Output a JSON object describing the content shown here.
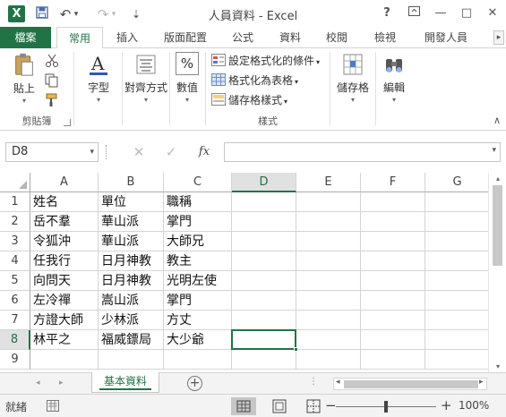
{
  "window": {
    "app_title": "人員資料 - Excel",
    "help": "?",
    "ribbon_display": "▭",
    "minimize": "—",
    "restore": "□",
    "close": "✕"
  },
  "quick_access": {
    "save": "💾",
    "undo": "↶",
    "undo_dd": "▾",
    "redo": "↷",
    "redo_dd": "▾",
    "customize": "⇣"
  },
  "ribbon_tabs": [
    "檔案",
    "常用",
    "插入",
    "版面配置",
    "公式",
    "資料",
    "校閱",
    "檢視",
    "開發人員"
  ],
  "ribbon_active_tab": "常用",
  "ribbon_tabs_scroll": "▸",
  "ribbon": {
    "clipboard": {
      "paste": "貼上",
      "group_label": "剪貼簿"
    },
    "font": {
      "label": "字型"
    },
    "alignment": {
      "label": "對齊方式"
    },
    "number": {
      "label": "數值",
      "symbol": "%"
    },
    "styles": {
      "conditional_formatting": "設定格式化的條件",
      "format_as_table": "格式化為表格",
      "cell_styles": "儲存格樣式",
      "group_label": "樣式"
    },
    "cells": {
      "label": "儲存格"
    },
    "editing": {
      "label": "編輯"
    },
    "dropdown_arrow": "▾",
    "collapse": "∧"
  },
  "formula_bar": {
    "name_box": "D8",
    "cancel": "✕",
    "enter": "✓",
    "fx": "fx",
    "formula": "",
    "dropdown": "▾"
  },
  "grid": {
    "columns": [
      "A",
      "B",
      "C",
      "D",
      "E",
      "F",
      "G"
    ],
    "rows": [
      "1",
      "2",
      "3",
      "4",
      "5",
      "6",
      "7",
      "8",
      "9"
    ],
    "active_cell": "D8",
    "cells": [
      [
        "姓名",
        "單位",
        "職稱"
      ],
      [
        "岳不羣",
        "華山派",
        "掌門"
      ],
      [
        "令狐沖",
        "華山派",
        "大師兄"
      ],
      [
        "任我行",
        "日月神教",
        "教主"
      ],
      [
        "向問天",
        "日月神教",
        "光明左使"
      ],
      [
        "左冷禪",
        "嵩山派",
        "掌門"
      ],
      [
        "方證大師",
        "少林派",
        "方丈"
      ],
      [
        "林平之",
        "福威鏢局",
        "大少爺"
      ],
      [
        "",
        "",
        ""
      ]
    ]
  },
  "scrollbar": {
    "up": "▴",
    "down": "▾",
    "left": "◂",
    "right": "▸"
  },
  "sheets": {
    "nav_prev": "◂",
    "nav_next": "▸",
    "tabs": [
      "基本資料"
    ],
    "active": "基本資料",
    "add": "+",
    "more": "⋮"
  },
  "status_bar": {
    "status": "就緒",
    "zoom_minus": "−",
    "zoom_plus": "+",
    "zoom_level": "100%",
    "zoom_fraction": 0.5
  },
  "colors": {
    "accent": "#217346",
    "gridline": "#d4d4d4"
  }
}
